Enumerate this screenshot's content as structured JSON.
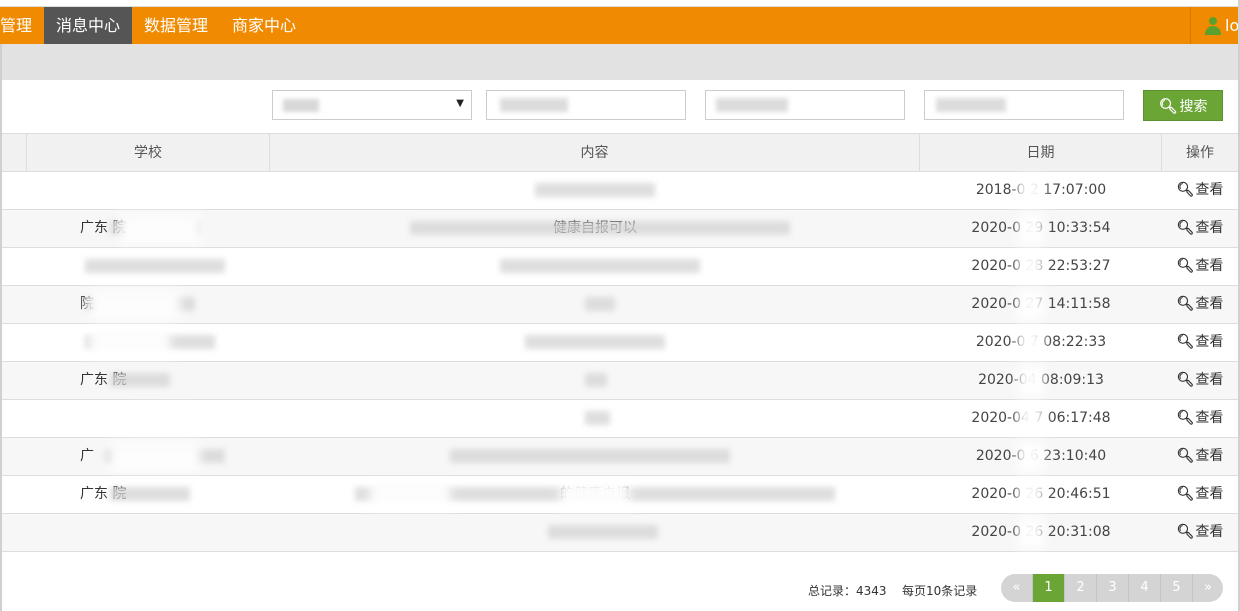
{
  "nav": {
    "items": [
      {
        "label": "管理",
        "active": false
      },
      {
        "label": "消息中心",
        "active": true
      },
      {
        "label": "数据管理",
        "active": false
      },
      {
        "label": "商家中心",
        "active": false
      }
    ],
    "user_label": "lo",
    "user_icon": "user-icon"
  },
  "filters": {
    "search_label": "搜索",
    "search_icon": "search-icon"
  },
  "table": {
    "headers": {
      "school": "学校",
      "content": "内容",
      "date": "日期",
      "op": "操作"
    },
    "view_label": "查看",
    "rows": [
      {
        "school": "",
        "content": "",
        "date": "2018-0  2 17:07:00"
      },
      {
        "school": "广东              院",
        "content": "     健康自报可以",
        "date": "2020-0  29 10:33:54"
      },
      {
        "school": "",
        "content": "",
        "date": "2020-0  28 22:53:27"
      },
      {
        "school": "            院",
        "content": "",
        "date": "2020-0  27 14:11:58"
      },
      {
        "school": "",
        "content": "",
        "date": "2020-0  7 08:22:33"
      },
      {
        "school": "广东           院",
        "content": "",
        "date": "2020-04   08:09:13"
      },
      {
        "school": "",
        "content": "",
        "date": "2020-04  7 06:17:48"
      },
      {
        "school": "广",
        "content": "",
        "date": "2020-0  6 23:10:40"
      },
      {
        "school": "广东              院",
        "content": "的健康自报",
        "date": "2020-0  26 20:46:51"
      },
      {
        "school": "",
        "content": "",
        "date": "2020-0  26 20:31:08"
      }
    ]
  },
  "footer": {
    "total": "总记录：4343",
    "per_page": "每页10条记录",
    "pages": [
      "«",
      "1",
      "2",
      "3",
      "4",
      "5",
      "»"
    ],
    "active_page": "1"
  },
  "colors": {
    "nav_bg": "#f08a00",
    "nav_active": "#555555",
    "accent_green": "#6aa536"
  }
}
